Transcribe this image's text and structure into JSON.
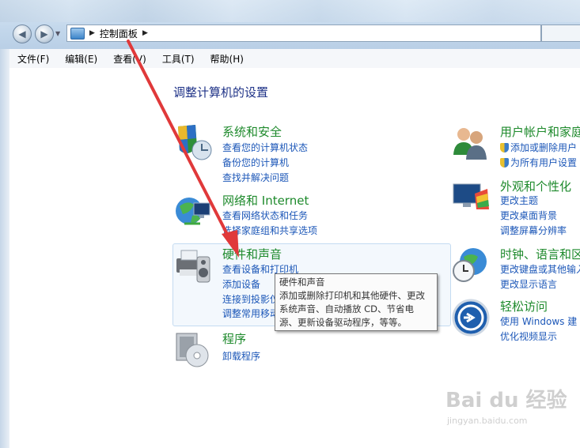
{
  "address": {
    "path": "控制面板"
  },
  "menu": [
    "文件(F)",
    "编辑(E)",
    "查看(V)",
    "工具(T)",
    "帮助(H)"
  ],
  "page_title": "调整计算机的设置",
  "categories": [
    {
      "title": "系统和安全",
      "icon": "shield-system-icon",
      "links": [
        "查看您的计算机状态",
        "备份您的计算机",
        "查找并解决问题"
      ]
    },
    {
      "title": "网络和 Internet",
      "icon": "network-globe-icon",
      "links": [
        "查看网络状态和任务",
        "选择家庭组和共享选项"
      ]
    },
    {
      "title": "硬件和声音",
      "icon": "printer-speaker-icon",
      "links": [
        "查看设备和打印机",
        "添加设备",
        "连接到投影仪",
        "调整常用移动"
      ]
    },
    {
      "title": "程序",
      "icon": "programs-disc-icon",
      "links": [
        "卸载程序"
      ]
    },
    {
      "title": "用户帐户和家庭",
      "icon": "user-accounts-icon",
      "links": [
        "添加或删除用户",
        "为所有用户设置"
      ]
    },
    {
      "title": "外观和个性化",
      "icon": "appearance-monitor-icon",
      "links": [
        "更改主题",
        "更改桌面背景",
        "调整屏幕分辨率"
      ]
    },
    {
      "title": "时钟、语言和区",
      "icon": "clock-globe-icon",
      "links": [
        "更改键盘或其他输入",
        "更改显示语言"
      ]
    },
    {
      "title": "轻松访问",
      "icon": "ease-of-access-icon",
      "links": [
        "使用 Windows 建",
        "优化视频显示"
      ]
    }
  ],
  "tooltip": {
    "title": "硬件和声音",
    "lines": [
      "添加或删除打印机和其他硬件、更改",
      "系统声音、自动播放 CD、节省电",
      "源、更新设备驱动程序，等等。"
    ]
  },
  "watermark": {
    "brand": "Bai du 经验",
    "url": "jingyan.baidu.com"
  },
  "colors": {
    "category_title": "#1e8a2c",
    "link": "#1c57b8",
    "page_title": "#1e3287",
    "annotation_arrow": "#e0393a"
  }
}
